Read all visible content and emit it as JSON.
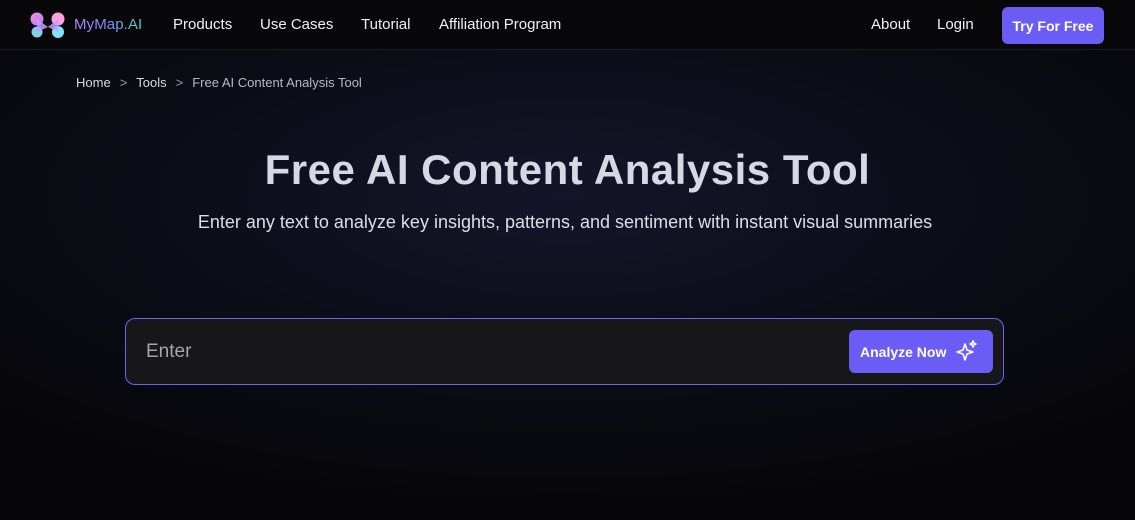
{
  "brand": {
    "name": "MyMap.AI"
  },
  "nav": {
    "items": [
      {
        "label": "Products"
      },
      {
        "label": "Use Cases"
      },
      {
        "label": "Tutorial"
      },
      {
        "label": "Affiliation Program"
      }
    ],
    "about": "About",
    "login": "Login",
    "cta": "Try For Free"
  },
  "breadcrumb": {
    "items": [
      "Home",
      "Tools",
      "Free AI Content Analysis Tool"
    ],
    "separator": ">"
  },
  "hero": {
    "title": "Free AI Content Analysis Tool",
    "subtitle": "Enter any text to analyze key insights, patterns, and sentiment with instant visual summaries"
  },
  "search": {
    "placeholder": "Enter",
    "value": "",
    "button_label": "Analyze Now",
    "button_icon": "sparkle-icon"
  },
  "colors": {
    "accent": "#6a5cf5",
    "background": "#07070b",
    "input_border": "#6c63ee"
  }
}
